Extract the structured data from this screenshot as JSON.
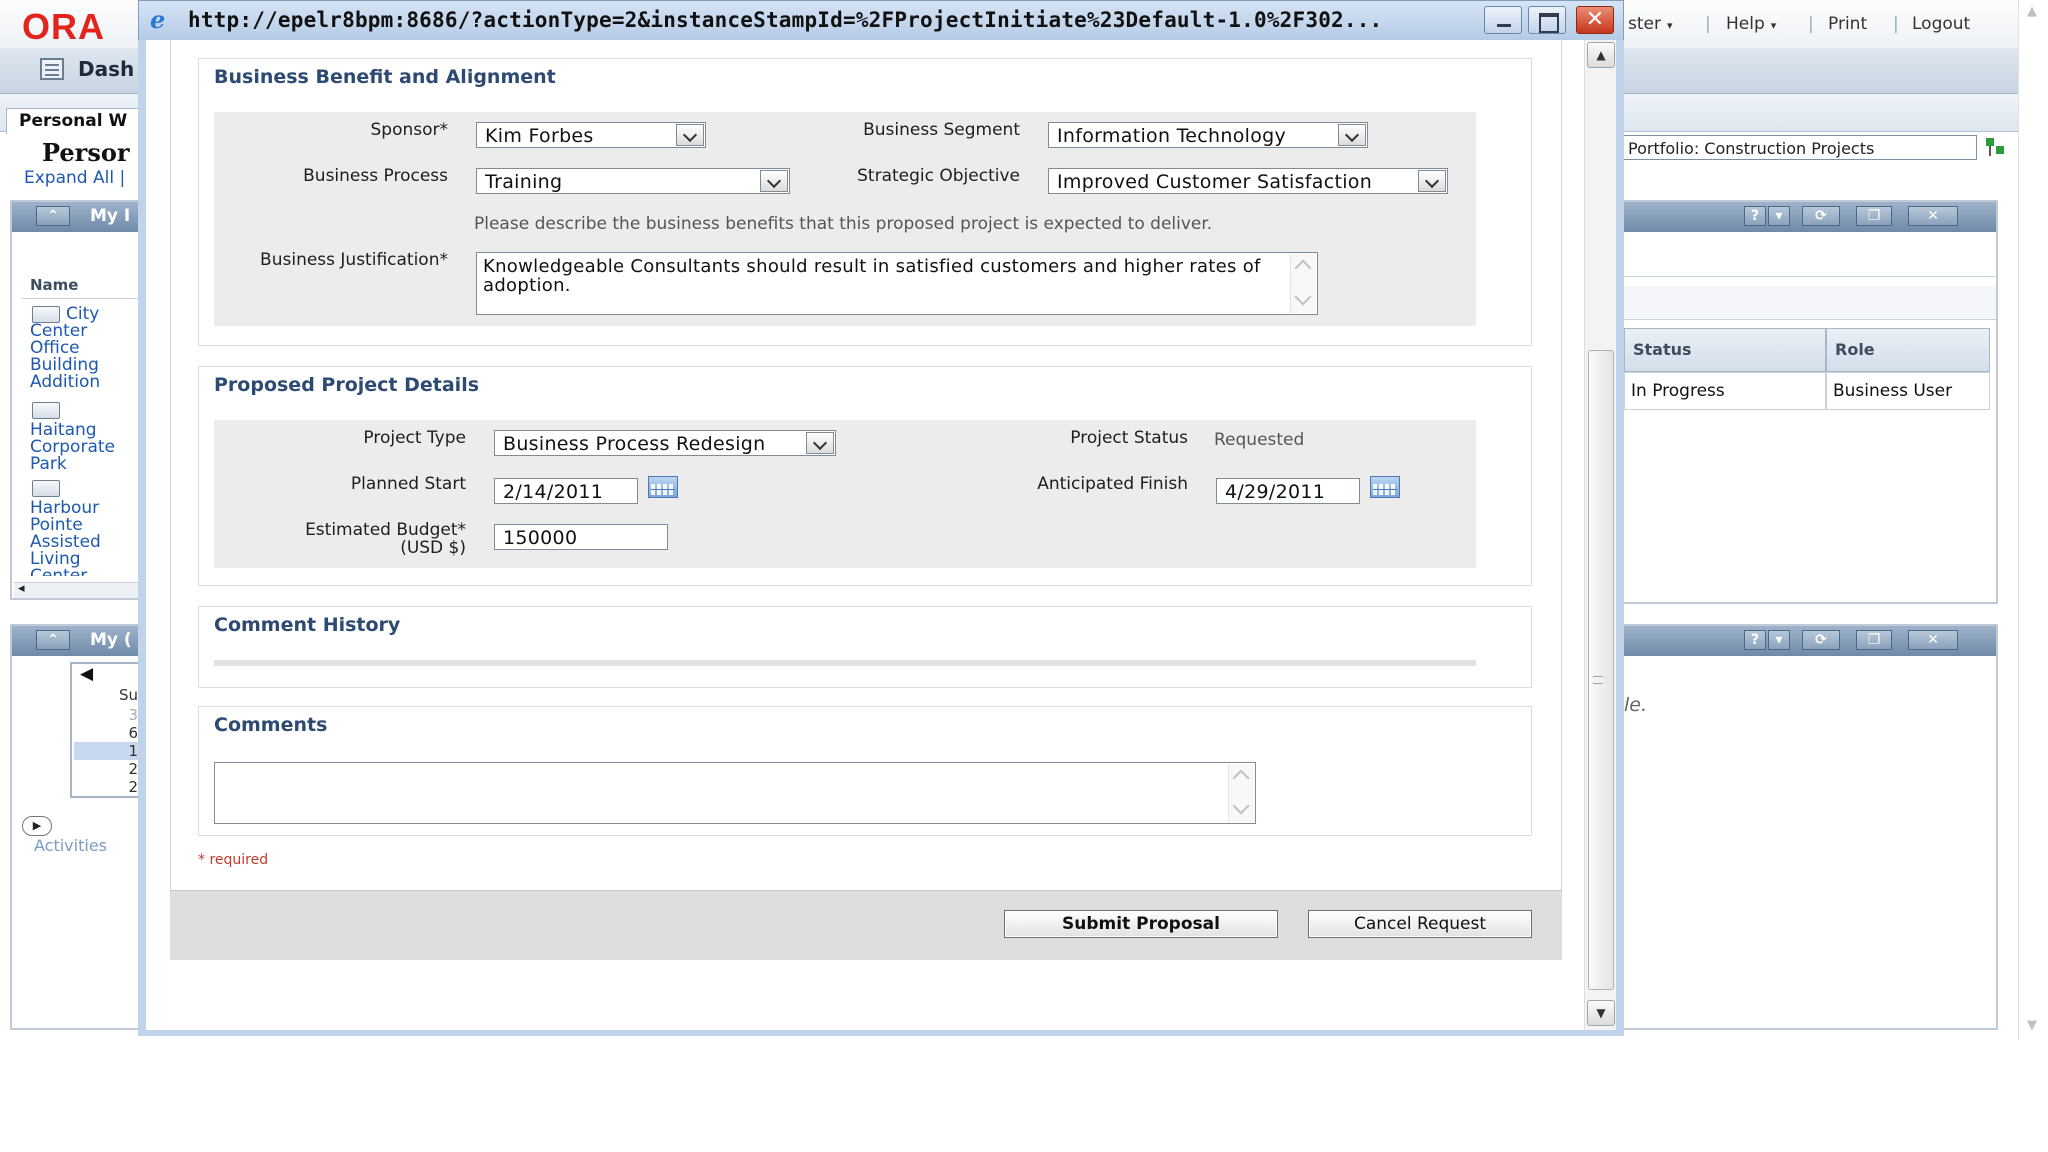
{
  "background": {
    "logo": "ORA",
    "top_links": [
      {
        "label": "ster",
        "caret": "▾"
      },
      {
        "label": "Help",
        "caret": "▾"
      },
      {
        "label": "Print",
        "caret": ""
      },
      {
        "label": "Logout",
        "caret": ""
      }
    ],
    "separator": "|",
    "dashboard_label": "Dash",
    "tab_label": "Personal W",
    "page_title": "Persor",
    "expand_all": "Expand All |",
    "portlet1_title": "My I",
    "portlet2_title": "My (",
    "name_header": "Name",
    "tree_items": [
      {
        "label": "City Center Office Building Addition"
      },
      {
        "label": "Haitang Corporate Park"
      },
      {
        "label": "Harbour Pointe Assisted Living Center"
      }
    ],
    "portfolio_value": "Portfolio: Construction Projects",
    "status_header": "Status",
    "role_header": "Role",
    "status_value": "In Progress",
    "role_value": "Business User",
    "no_data_fragment": "le.",
    "calendar_day_header": "Su",
    "calendar_days": [
      "3",
      "6",
      "1",
      "2",
      "2"
    ],
    "activities_label": "Activities",
    "portlet_icons": [
      "help-icon",
      "dropdown-icon",
      "refresh-icon",
      "restore-icon",
      "close-icon"
    ]
  },
  "popup": {
    "url": "http://epelr8bpm:8686/?actionType=2&instanceStampId=%2FProjectInitiate%23Default-1.0%2F302...",
    "sections": {
      "benefit": {
        "title": "Business Benefit and Alignment",
        "sponsor_label": "Sponsor*",
        "sponsor_value": "Kim Forbes",
        "segment_label": "Business Segment",
        "segment_value": "Information Technology",
        "process_label": "Business Process",
        "process_value": "Training",
        "objective_label": "Strategic Objective",
        "objective_value": "Improved Customer Satisfaction",
        "hint": "Please describe the business benefits that this proposed project is expected to deliver.",
        "justification_label": "Business Justification*",
        "justification_value": "Knowledgeable Consultants should result in satisfied customers and higher rates of adoption."
      },
      "project": {
        "title": "Proposed Project Details",
        "type_label": "Project Type",
        "type_value": "Business Process Redesign",
        "status_label": "Project Status",
        "status_value": "Requested",
        "start_label": "Planned Start",
        "start_value": "2/14/2011",
        "finish_label": "Anticipated Finish",
        "finish_value": "4/29/2011",
        "budget_label_1": "Estimated Budget*",
        "budget_label_2": "(USD $)",
        "budget_value": "150000"
      },
      "history": {
        "title": "Comment History"
      },
      "comments": {
        "title": "Comments",
        "value": ""
      }
    },
    "required_note": "* required",
    "submit_label": "Submit Proposal",
    "cancel_label": "Cancel Request"
  }
}
